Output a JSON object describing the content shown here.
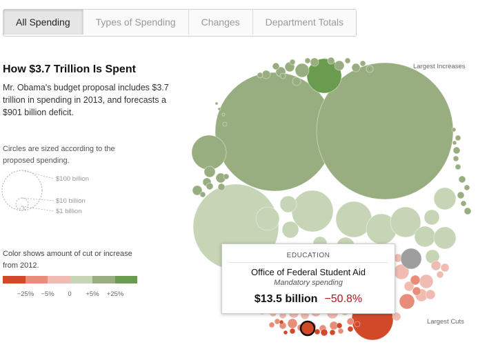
{
  "tabs": [
    {
      "label": "All Spending",
      "active": true
    },
    {
      "label": "Types of Spending",
      "active": false
    },
    {
      "label": "Changes",
      "active": false
    },
    {
      "label": "Department Totals",
      "active": false
    }
  ],
  "intro": {
    "title": "How $3.7 Trillion Is Spent",
    "description": "Mr. Obama's budget proposal includes $3.7 trillion in spending in 2013, and forecasts a $901 billion deficit."
  },
  "size_legend": {
    "note": "Circles are sized according to the proposed spending.",
    "labels": [
      "$100 billion",
      "$10 billion",
      "$1 billion"
    ]
  },
  "color_legend": {
    "note": "Color shows amount of cut or increase from 2012.",
    "colors": [
      "#d2492a",
      "#e88d7a",
      "#f0bcb2",
      "#c6d5b5",
      "#98ae80",
      "#6a9b4e"
    ],
    "labels": [
      "−25%",
      "−5%",
      "0",
      "+5%",
      "+25%"
    ]
  },
  "annotations": {
    "largest_increases": "Largest Increases",
    "largest_cuts": "Largest Cuts"
  },
  "tooltip": {
    "category": "EDUCATION",
    "name": "Office of Federal Student Aid",
    "type": "Mandatory spending",
    "amount": "$13.5 billion",
    "change": "−50.8%"
  }
}
